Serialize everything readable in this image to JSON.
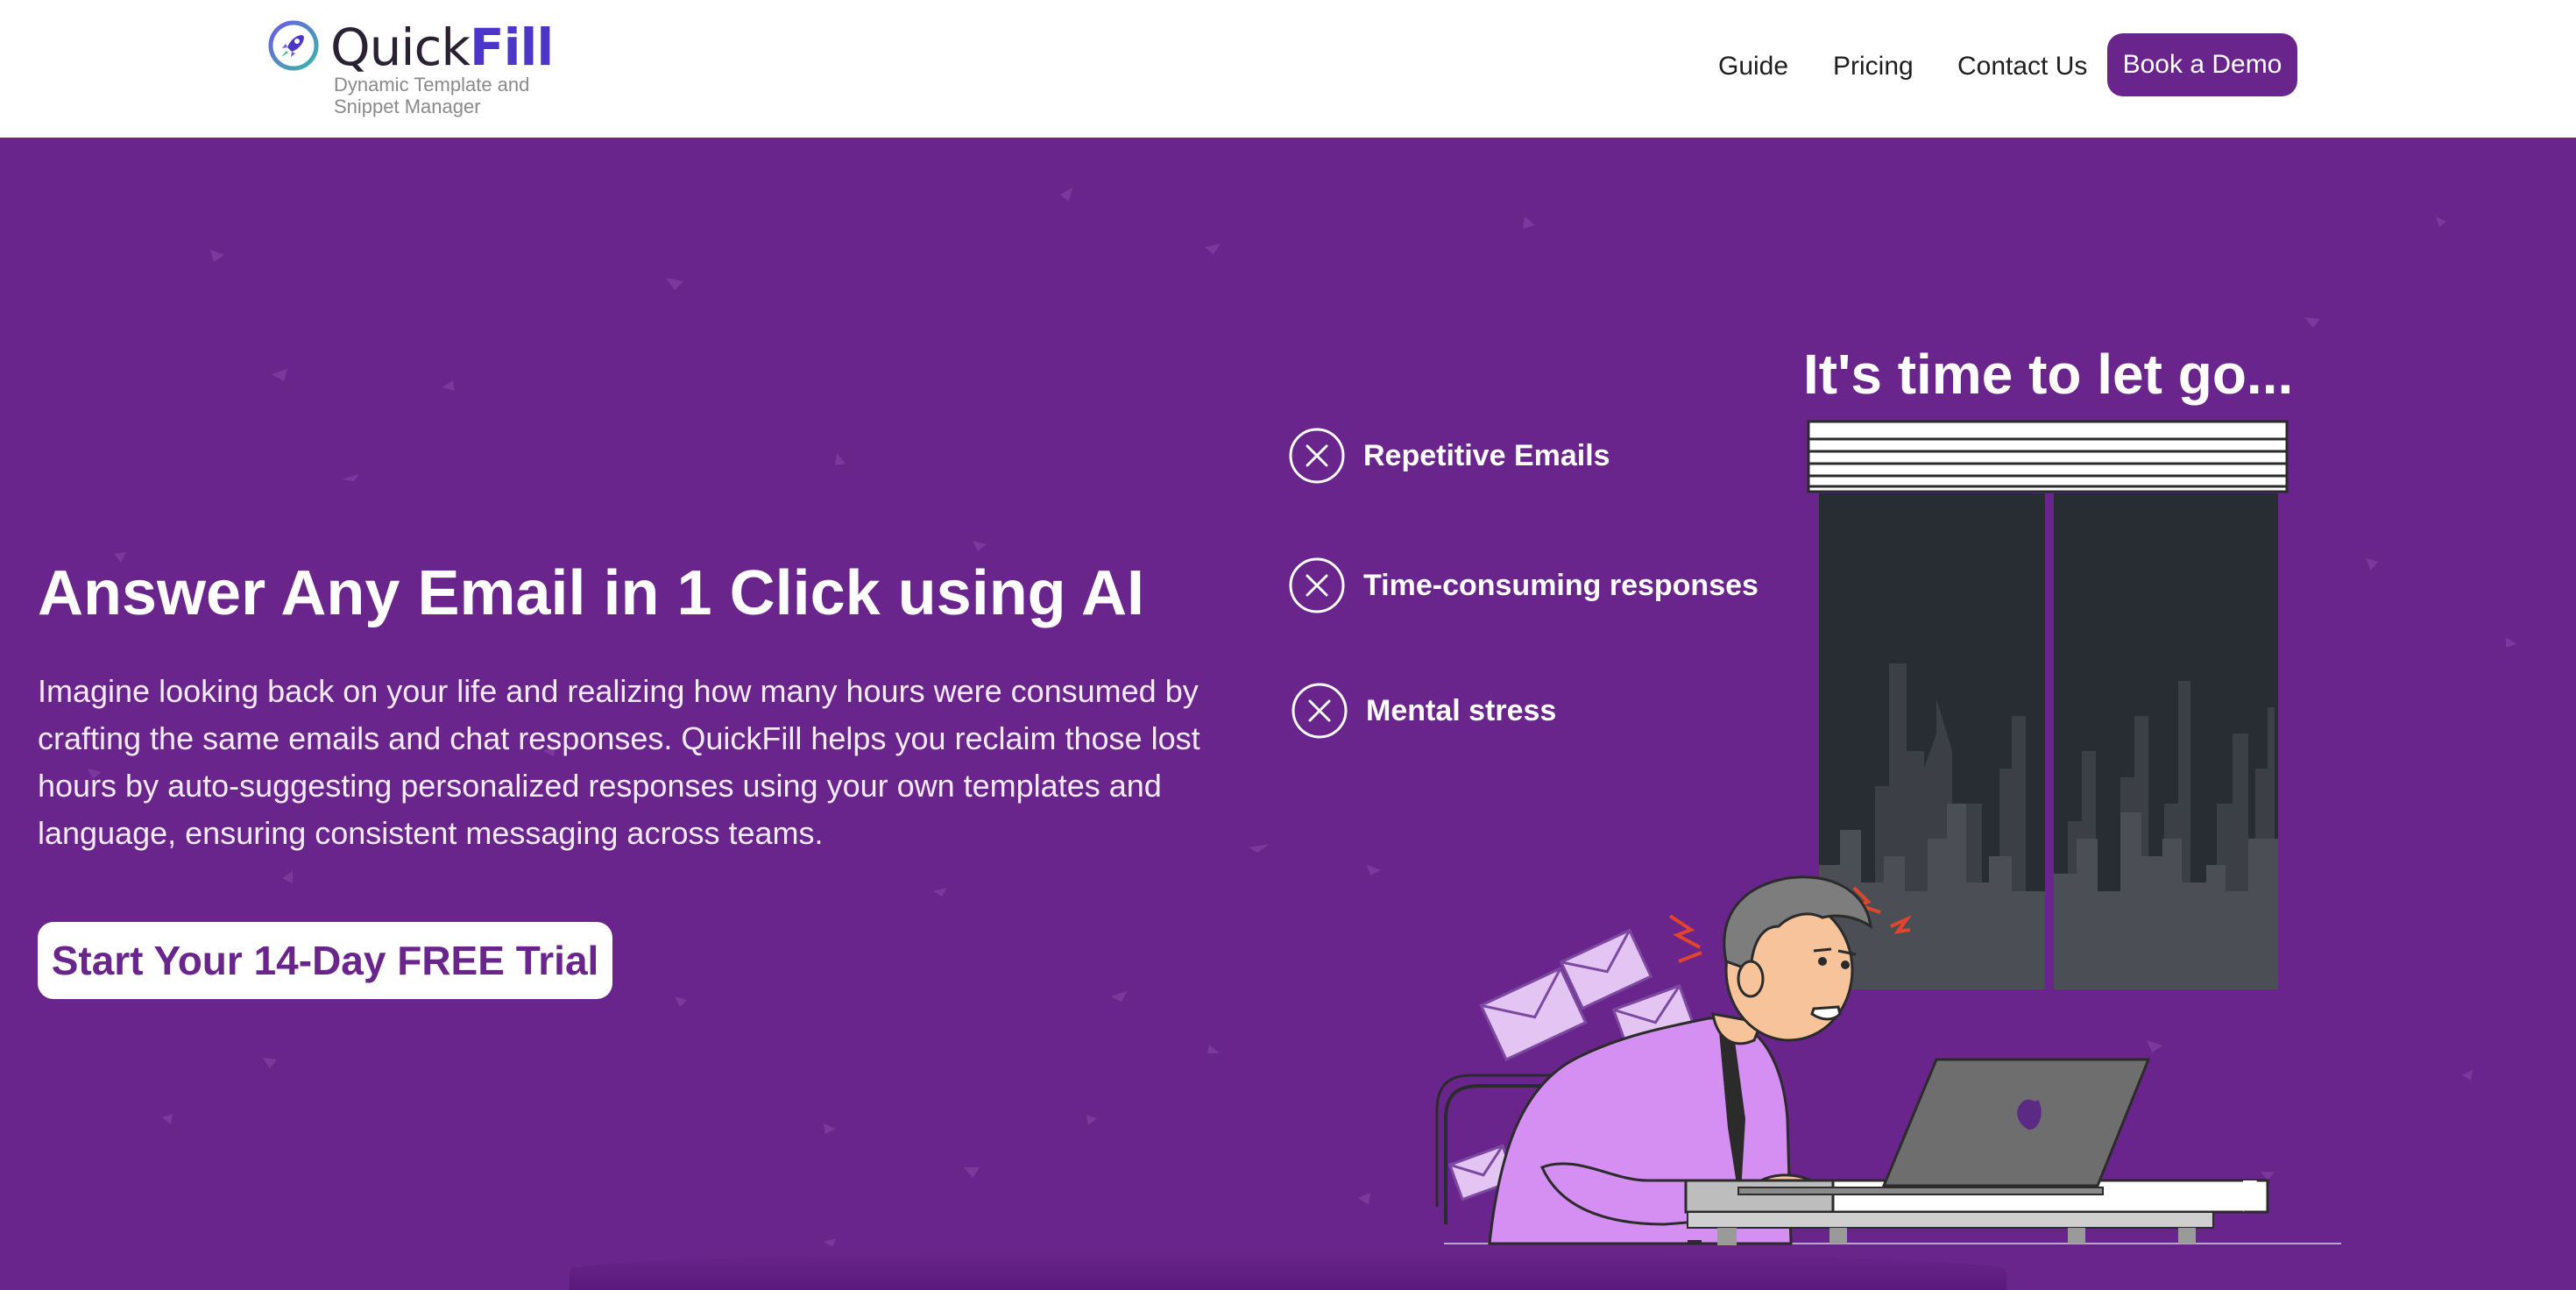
{
  "brand": {
    "name_part1": "Quick",
    "name_part2": "Fill",
    "tagline": "Dynamic Template and Snippet Manager",
    "icon": "rocket-icon",
    "brand_color": "#4b36c9"
  },
  "nav": {
    "links": [
      "Guide",
      "Pricing",
      "Contact Us"
    ],
    "demo_button": "Book a Demo"
  },
  "hero": {
    "headline": "Answer Any Email in 1 Click using AI",
    "subtext": "Imagine looking back on your life and realizing how many hours were consumed by crafting the same emails and chat responses. QuickFill helps you reclaim those lost hours by auto-suggesting personalized responses using your own templates and language, ensuring consistent messaging across teams.",
    "cta": "Start Your 14-Day FREE Trial",
    "illustration_title": "It's time to let go...",
    "pain_points": [
      {
        "label": "Repetitive Emails",
        "icon": "x-circle-icon"
      },
      {
        "label": "Time-consuming responses",
        "icon": "x-circle-icon"
      },
      {
        "label": "Mental stress",
        "icon": "x-circle-icon"
      }
    ]
  },
  "colors": {
    "hero_background": "#6a258c",
    "header_background": "#ffffff",
    "cta_text": "#6a258c"
  }
}
